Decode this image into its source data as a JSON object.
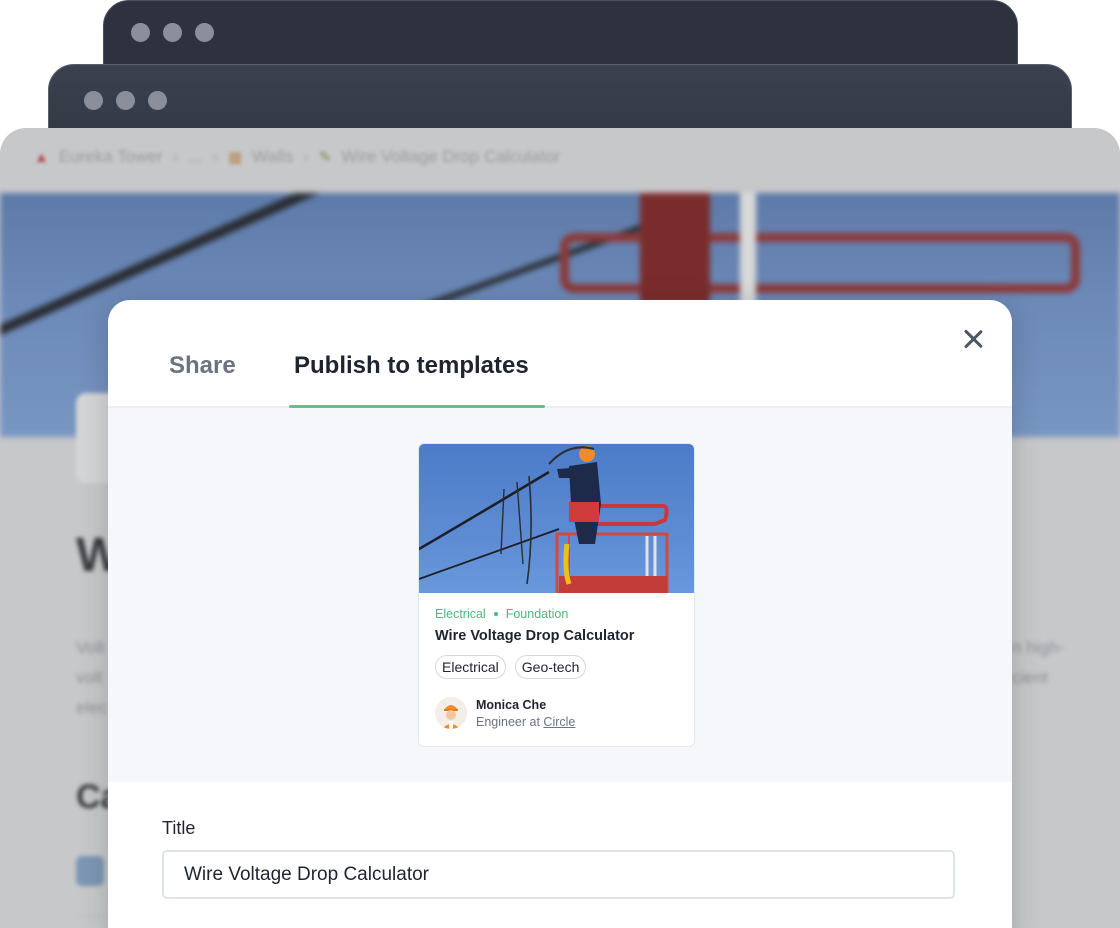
{
  "background": {
    "breadcrumb": [
      {
        "icon": "tower-icon",
        "label": "Eureka Tower"
      },
      {
        "icon": "",
        "label": "..."
      },
      {
        "icon": "wall-icon",
        "label": "Walls"
      },
      {
        "icon": "pencil-icon",
        "label": "Wire Voltage Drop Calculator"
      }
    ],
    "page_initial": "W",
    "para_lines": [
      "Volt",
      "volt",
      "elec"
    ],
    "para_right_lines": [
      "n high-",
      "cient"
    ],
    "section_initial": "Ca"
  },
  "modal": {
    "tabs": [
      {
        "label": "Share",
        "active": false
      },
      {
        "label": "Publish to templates",
        "active": true
      }
    ],
    "accent_color": "#5cc48a",
    "card": {
      "categories": [
        "Electrical",
        "Foundation"
      ],
      "title": "Wire Voltage Drop Calculator",
      "tags": [
        "Electrical",
        "Geo-tech"
      ],
      "author": {
        "name": "Monica Che",
        "role_prefix": "Engineer at",
        "company": "Circle"
      }
    },
    "form": {
      "title_label": "Title",
      "title_value": "Wire Voltage Drop Calculator"
    }
  }
}
